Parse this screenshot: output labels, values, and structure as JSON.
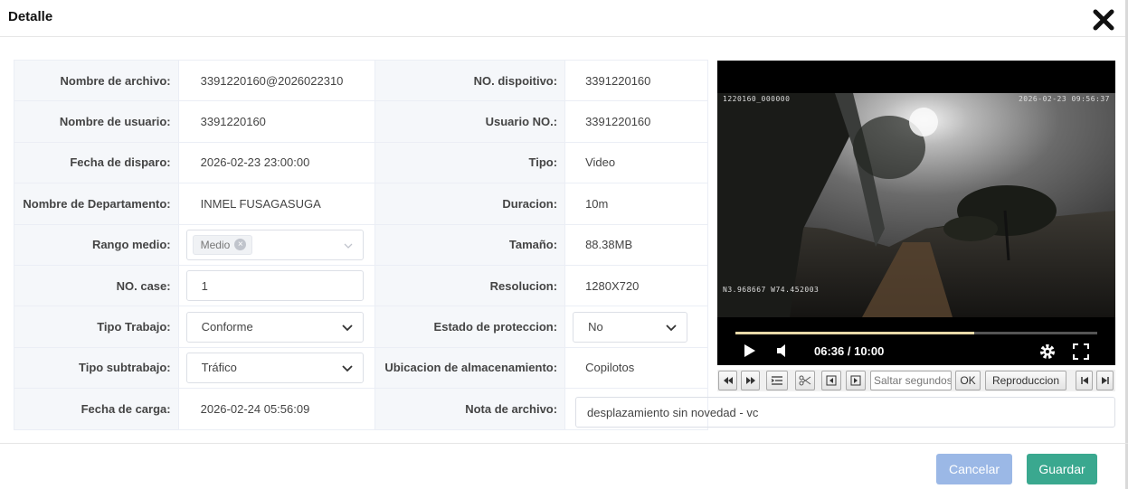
{
  "dialog": {
    "title": "Detalle"
  },
  "fields": {
    "nombre_archivo": {
      "label": "Nombre de archivo:",
      "value": "3391220160@2026022310"
    },
    "no_dispositivo": {
      "label": "NO. dispoitivo:",
      "value": "3391220160"
    },
    "nombre_usuario": {
      "label": "Nombre de usuario:",
      "value": "3391220160"
    },
    "usuario_no": {
      "label": "Usuario NO.:",
      "value": "3391220160"
    },
    "fecha_disparo": {
      "label": "Fecha de disparo:",
      "value": "2026-02-23 23:00:00"
    },
    "tipo": {
      "label": "Tipo:",
      "value": "Video"
    },
    "departamento": {
      "label": "Nombre de Departamento:",
      "value": "INMEL FUSAGASUGA"
    },
    "duracion": {
      "label": "Duracion:",
      "value": "10m"
    },
    "rango_medio": {
      "label": "Rango medio:",
      "tag": "Medio"
    },
    "tamano": {
      "label": "Tamaño:",
      "value": "88.38MB"
    },
    "no_case": {
      "label": "NO. case:",
      "value": "1"
    },
    "resolucion": {
      "label": "Resolucion:",
      "value": "1280X720"
    },
    "tipo_trabajo": {
      "label": "Tipo Trabajo:",
      "value": "Conforme"
    },
    "estado_proteccion": {
      "label": "Estado de proteccion:",
      "value": "No"
    },
    "tipo_subtrabajo": {
      "label": "Tipo subtrabajo:",
      "value": "Tráfico"
    },
    "ubicacion": {
      "label": "Ubicacion de almacenamiento:",
      "value": "Copilotos"
    },
    "fecha_carga": {
      "label": "Fecha de carga:",
      "value": "2026-02-24 05:56:09"
    },
    "nota": {
      "label": "Nota de archivo:",
      "value": "desplazamiento sin novedad - vc"
    }
  },
  "video": {
    "osd_left": "1220160_000000",
    "osd_right": "2026-02-23 09:56:37",
    "gps": "N3.968667 W74.452003",
    "time": "06:36 / 10:00",
    "progress": 0.66
  },
  "toolbar": {
    "seek_placeholder": "Saltar segundos",
    "ok_label": "OK",
    "play_label": "Reproduccion"
  },
  "footer": {
    "cancel": "Cancelar",
    "save": "Guardar"
  }
}
